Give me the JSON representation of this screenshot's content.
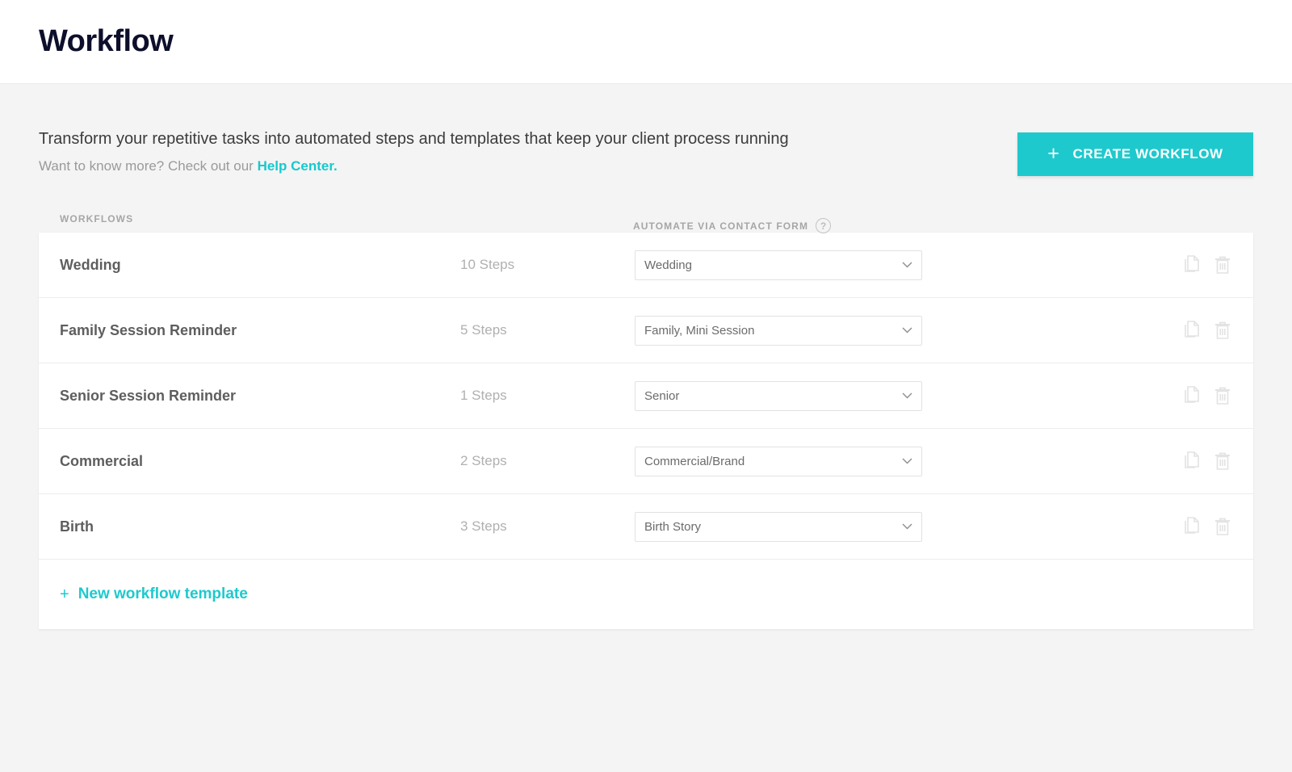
{
  "header": {
    "title": "Workflow"
  },
  "intro": {
    "line1": "Transform your repetitive tasks into automated steps and templates that keep your client process running",
    "line2_prefix": "Want to know more? Check out our ",
    "help_link": "Help Center.",
    "create_button": "CREATE WORKFLOW",
    "create_button_icon": "plus-icon"
  },
  "table": {
    "col_workflows": "WORKFLOWS",
    "col_automate": "AUTOMATE VIA CONTACT FORM",
    "help_icon_glyph": "?",
    "rows": [
      {
        "name": "Wedding",
        "steps": "10 Steps",
        "contact_form": "Wedding",
        "duplicate_icon": "copy-icon",
        "delete_icon": "trash-icon"
      },
      {
        "name": "Family Session Reminder",
        "steps": "5 Steps",
        "contact_form": "Family, Mini Session",
        "duplicate_icon": "copy-icon",
        "delete_icon": "trash-icon"
      },
      {
        "name": "Senior Session Reminder",
        "steps": "1 Steps",
        "contact_form": "Senior",
        "duplicate_icon": "copy-icon",
        "delete_icon": "trash-icon"
      },
      {
        "name": "Commercial",
        "steps": "2 Steps",
        "contact_form": "Commercial/Brand",
        "duplicate_icon": "copy-icon",
        "delete_icon": "trash-icon"
      },
      {
        "name": "Birth",
        "steps": "3 Steps",
        "contact_form": "Birth Story",
        "duplicate_icon": "copy-icon",
        "delete_icon": "trash-icon"
      }
    ],
    "new_template_label": "New workflow template",
    "new_template_plus": "+"
  },
  "colors": {
    "accent": "#1ec9cd",
    "title": "#0d0f2b",
    "page_bg": "#f4f4f4",
    "card_bg": "#ffffff"
  }
}
